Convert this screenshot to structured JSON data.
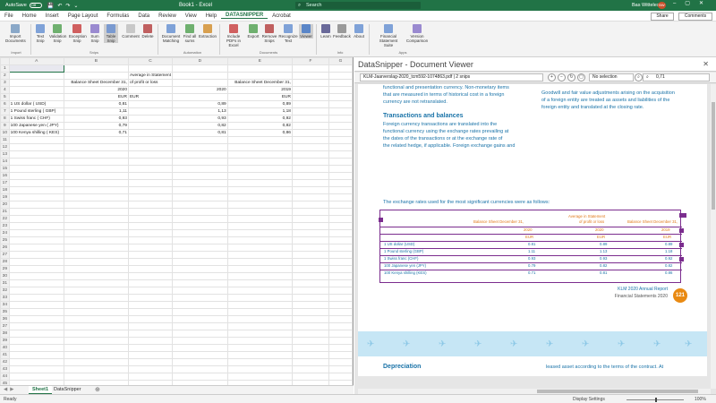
{
  "titlebar": {
    "autosave": "AutoSave",
    "autosave_state": "Off",
    "doc_title": "Book1 - Excel",
    "search_placeholder": "Search",
    "user": "Bas Witteles",
    "avatar": "BW"
  },
  "menu": {
    "tabs": [
      "File",
      "Home",
      "Insert",
      "Page Layout",
      "Formulas",
      "Data",
      "Review",
      "View",
      "Help",
      "DATASNIPPER",
      "Acrobat"
    ],
    "active": "DATASNIPPER",
    "share": "Share",
    "comments": "Comments"
  },
  "ribbon": {
    "buttons": [
      "Import Documents",
      "Text Snip",
      "Validation Snip",
      "Exception Snip",
      "Sum Snip",
      "Table Snip",
      "Comment",
      "Delete",
      "Document Matching",
      "Find all sums",
      "Extraction",
      "Include PDFs in Excel",
      "Export",
      "Remove Snips",
      "Recognize Text",
      "Viewer",
      "Learn",
      "Feedback",
      "About",
      "Financial Statement Suite",
      "Version Comparison"
    ],
    "groups": [
      "Import",
      "Snips",
      "Automation",
      "Documents",
      "Info",
      "Apps"
    ]
  },
  "sheet": {
    "columns": [
      "A",
      "B",
      "C",
      "D",
      "E",
      "F",
      "G"
    ],
    "rows": [
      [
        "",
        "",
        "",
        "",
        "",
        ""
      ],
      [
        "",
        "",
        "Average in Statement",
        "",
        "",
        ""
      ],
      [
        "",
        "Balance Sheet December 31,",
        "of profit or loss",
        "",
        "Balance Sheet December 31,",
        ""
      ],
      [
        "",
        "2020",
        "",
        "2020",
        "2019",
        ""
      ],
      [
        "",
        "EUR",
        "EUR",
        "",
        "EUR",
        ""
      ],
      [
        "1 US dollar ( USD)",
        "0,81",
        "",
        "0,89",
        "0,89",
        ""
      ],
      [
        "1 Pound sterling ( GBP)",
        "1,11",
        "",
        "1,13",
        "1,18",
        ""
      ],
      [
        "1 Swiss franc ( CHF)",
        "0,93",
        "",
        "0,93",
        "0,92",
        ""
      ],
      [
        "100 Japanese yen ( JPY)",
        "0,79",
        "",
        "0,82",
        "0,82",
        ""
      ],
      [
        "100 Kenya shilling ( KES)",
        "0,71",
        "",
        "0,81",
        "0,86",
        ""
      ]
    ],
    "row_count": 46,
    "tabs": [
      "Sheet1",
      "DataSnipper"
    ]
  },
  "status": {
    "ready": "Ready",
    "display": "Display Settings",
    "zoom": "100%"
  },
  "viewer": {
    "title": "DataSnipper - Document Viewer",
    "file": "KLM-Jaarverslag-2020_tcm592-1074863.pdf | 2 snips",
    "selection": "No selection",
    "search": "0,71",
    "col1_top": [
      "functional and presentation currency. Non-monetary items",
      "that are measured in terms of historical cost in a foreign",
      "currency are not retranslated."
    ],
    "col2_top": [
      "Goodwill and fair value adjustments arising on the acquisition",
      "of a foreign entity are treated as assets and liabilities of the",
      "foreign entity and translated at the closing rate."
    ],
    "heading": "Transactions and balances",
    "col1_body": [
      "Foreign currency transactions are translated into the",
      "functional currency using the exchange rates prevailing at",
      "the dates of the transactions or at the exchange rate of",
      "the related hedge, if applicable. Foreign exchange gains and"
    ],
    "rates_intro": "The exchange rates used for the most significant currencies were as follows:",
    "table_head": [
      "Average in Statement",
      "Balance Sheet December 31,",
      "of profit or loss",
      "Balance Sheet December 31,",
      "2020",
      "2020",
      "2019",
      "EUR",
      "EUR",
      "EUR"
    ],
    "table_rows": [
      [
        "1 US dollar (USD)",
        "0.81",
        "0.89",
        "0.89"
      ],
      [
        "1 Pound sterling (GBP)",
        "1.11",
        "1.13",
        "1.18"
      ],
      [
        "1 Swiss franc (CHF)",
        "0.93",
        "0.93",
        "0.92"
      ],
      [
        "100 Japanese yen (JPY)",
        "0.79",
        "0.82",
        "0.82"
      ],
      [
        "100 Kenya shilling (KES)",
        "0.71",
        "0.81",
        "0.86"
      ]
    ],
    "footer1": "KLM 2020 Annual Report",
    "footer2": "Financial Statements 2020",
    "page_num": "121",
    "depreciation": "Depreciation",
    "lease_text": "leased asset according to the terms of the contract. At"
  }
}
